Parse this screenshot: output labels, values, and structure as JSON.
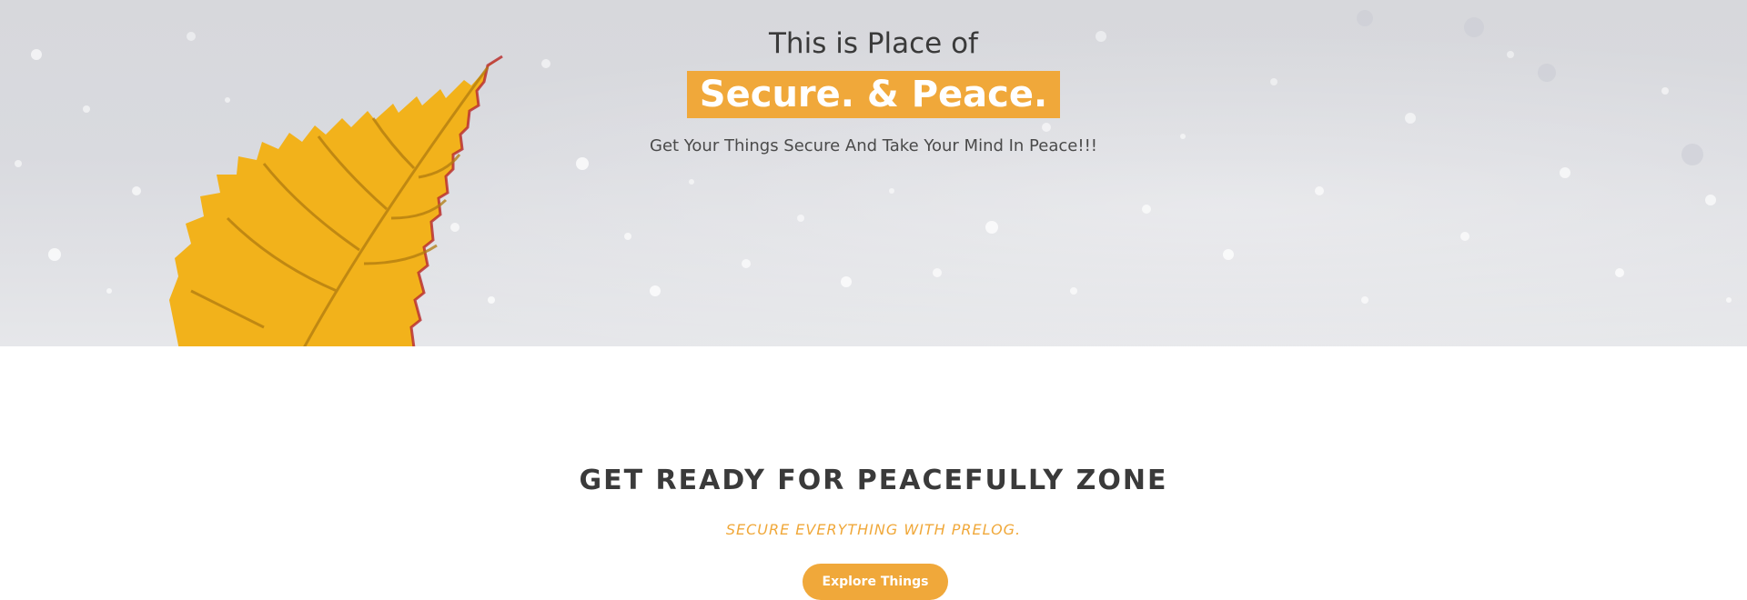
{
  "hero": {
    "title": "This is Place of",
    "highlight": "Secure. & Peace.",
    "subtitle": "Get Your Things Secure And Take Your Mind In Peace!!!"
  },
  "section": {
    "title": "GET READY FOR PEACEFULLY ZONE",
    "tagline": "SECURE EVERYTHING WITH PRELOG.",
    "button_label": "Explore Things"
  },
  "colors": {
    "accent": "#f0a83a",
    "text_dark": "#3a3a3a",
    "hero_background": "#d9dadf",
    "leaf": "#f2b21b"
  },
  "icons": {
    "hero_image": "yellow-leaf-on-snow"
  }
}
